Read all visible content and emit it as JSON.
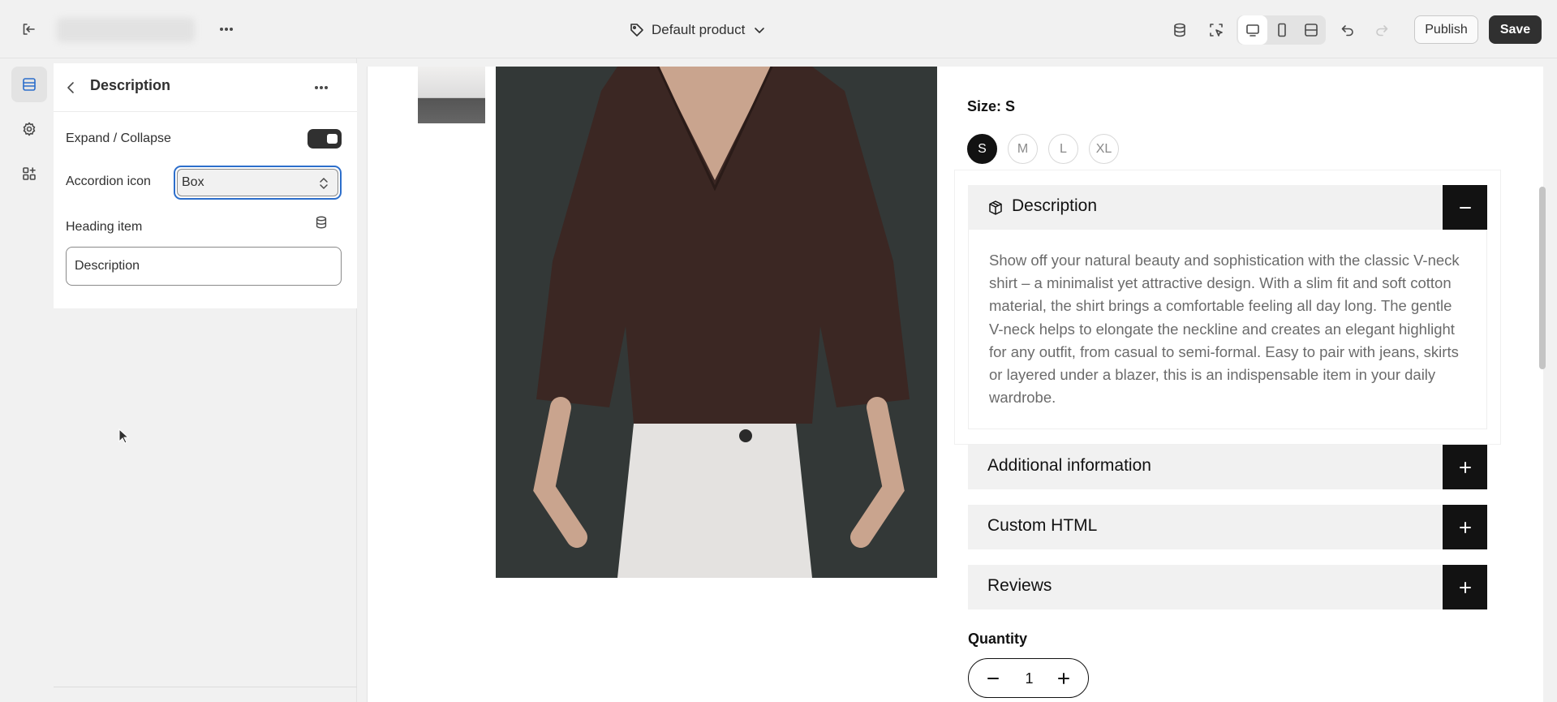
{
  "topbar": {
    "template_label": "Default product",
    "publish_label": "Publish",
    "save_label": "Save"
  },
  "panel": {
    "title": "Description",
    "expand_collapse_label": "Expand / Collapse",
    "expand_collapse_on": true,
    "accordion_icon_label": "Accordion icon",
    "accordion_icon_value": "Box",
    "heading_item_label": "Heading item",
    "heading_item_value": "Description"
  },
  "product": {
    "size_label": "Size: S",
    "sizes": [
      "S",
      "M",
      "L",
      "XL"
    ],
    "selected_size": "S",
    "accordion": {
      "open_title": "Description",
      "open_body": "Show off your natural beauty and sophistication with the classic V-neck shirt – a minimalist yet attractive design. With a slim fit and soft cotton material, the shirt brings a comfortable feeling all day long. The gentle V-neck helps to elongate the neckline and creates an elegant highlight for any outfit, from casual to semi-formal. Easy to pair with jeans, skirts or layered under a blazer, this is an indispensable item in your daily wardrobe.",
      "collapsed": [
        "Additional information",
        "Custom HTML",
        "Reviews"
      ]
    },
    "quantity_label": "Quantity",
    "quantity_value": "1"
  },
  "colors": {
    "accent": "#2c6ecb",
    "dark": "#121212",
    "panel_bg": "#f1f1f1"
  }
}
